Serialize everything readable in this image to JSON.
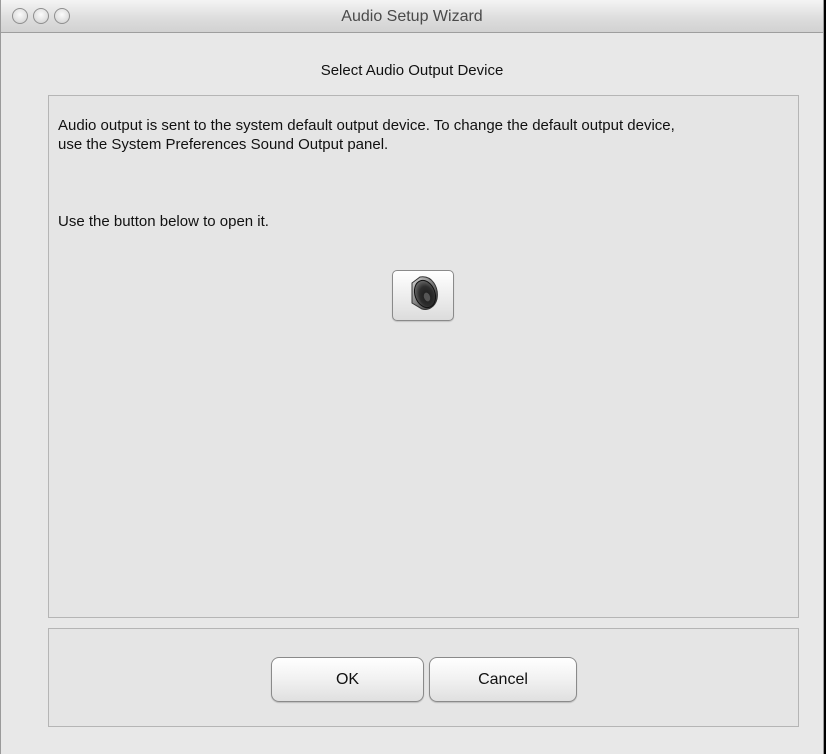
{
  "window": {
    "title": "Audio Setup Wizard"
  },
  "wizard": {
    "heading": "Select Audio Output Device",
    "description": "Audio output is sent to the system default output device. To change the default output device, use the System Preferences Sound Output panel.",
    "instruction": "Use the button below to open it.",
    "sound_button_icon": "speaker-icon"
  },
  "buttons": {
    "ok_label": "OK",
    "cancel_label": "Cancel"
  }
}
